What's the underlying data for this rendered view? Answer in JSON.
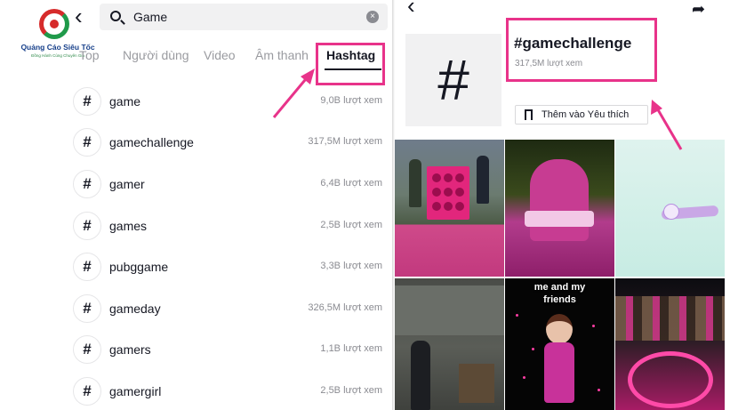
{
  "logo": {
    "name": "Quảng Cáo Siêu Tốc",
    "tagline": "Đồng Hành Cùng Chuyên Gia"
  },
  "search": {
    "query": "Game"
  },
  "tabs": [
    {
      "label": "Top"
    },
    {
      "label": "Người dùng"
    },
    {
      "label": "Video"
    },
    {
      "label": "Âm thanh"
    },
    {
      "label": "Hashtag",
      "active": true
    }
  ],
  "results": [
    {
      "name": "game",
      "views": "9,0B lượt xem"
    },
    {
      "name": "gamechallenge",
      "views": "317,5M lượt xem"
    },
    {
      "name": "gamer",
      "views": "6,4B lượt xem"
    },
    {
      "name": "games",
      "views": "2,5B lượt xem"
    },
    {
      "name": "pubggame",
      "views": "3,3B lượt xem"
    },
    {
      "name": "gameday",
      "views": "326,5M lượt xem"
    },
    {
      "name": "gamers",
      "views": "1,1B lượt xem"
    },
    {
      "name": "gamergirl",
      "views": "2,5B lượt xem"
    }
  ],
  "hashtag_symbol": "#",
  "detail": {
    "title": "#gamechallenge",
    "views": "317,5M lượt xem",
    "favorite_label": "Thêm vào Yêu thích"
  },
  "videos": [
    {
      "overlay": ""
    },
    {
      "overlay": ""
    },
    {
      "overlay": ""
    },
    {
      "overlay": ""
    },
    {
      "overlay": "me and my",
      "overlay2": "friends"
    },
    {
      "overlay": ""
    }
  ],
  "colors": {
    "highlight": "#e8338a",
    "text": "#161823",
    "muted": "#8a8b91",
    "search_bg": "#f1f1f2"
  },
  "icons": [
    "search-icon",
    "clear-icon",
    "back-icon",
    "share-icon",
    "hashtag-icon",
    "bookmark-icon"
  ]
}
